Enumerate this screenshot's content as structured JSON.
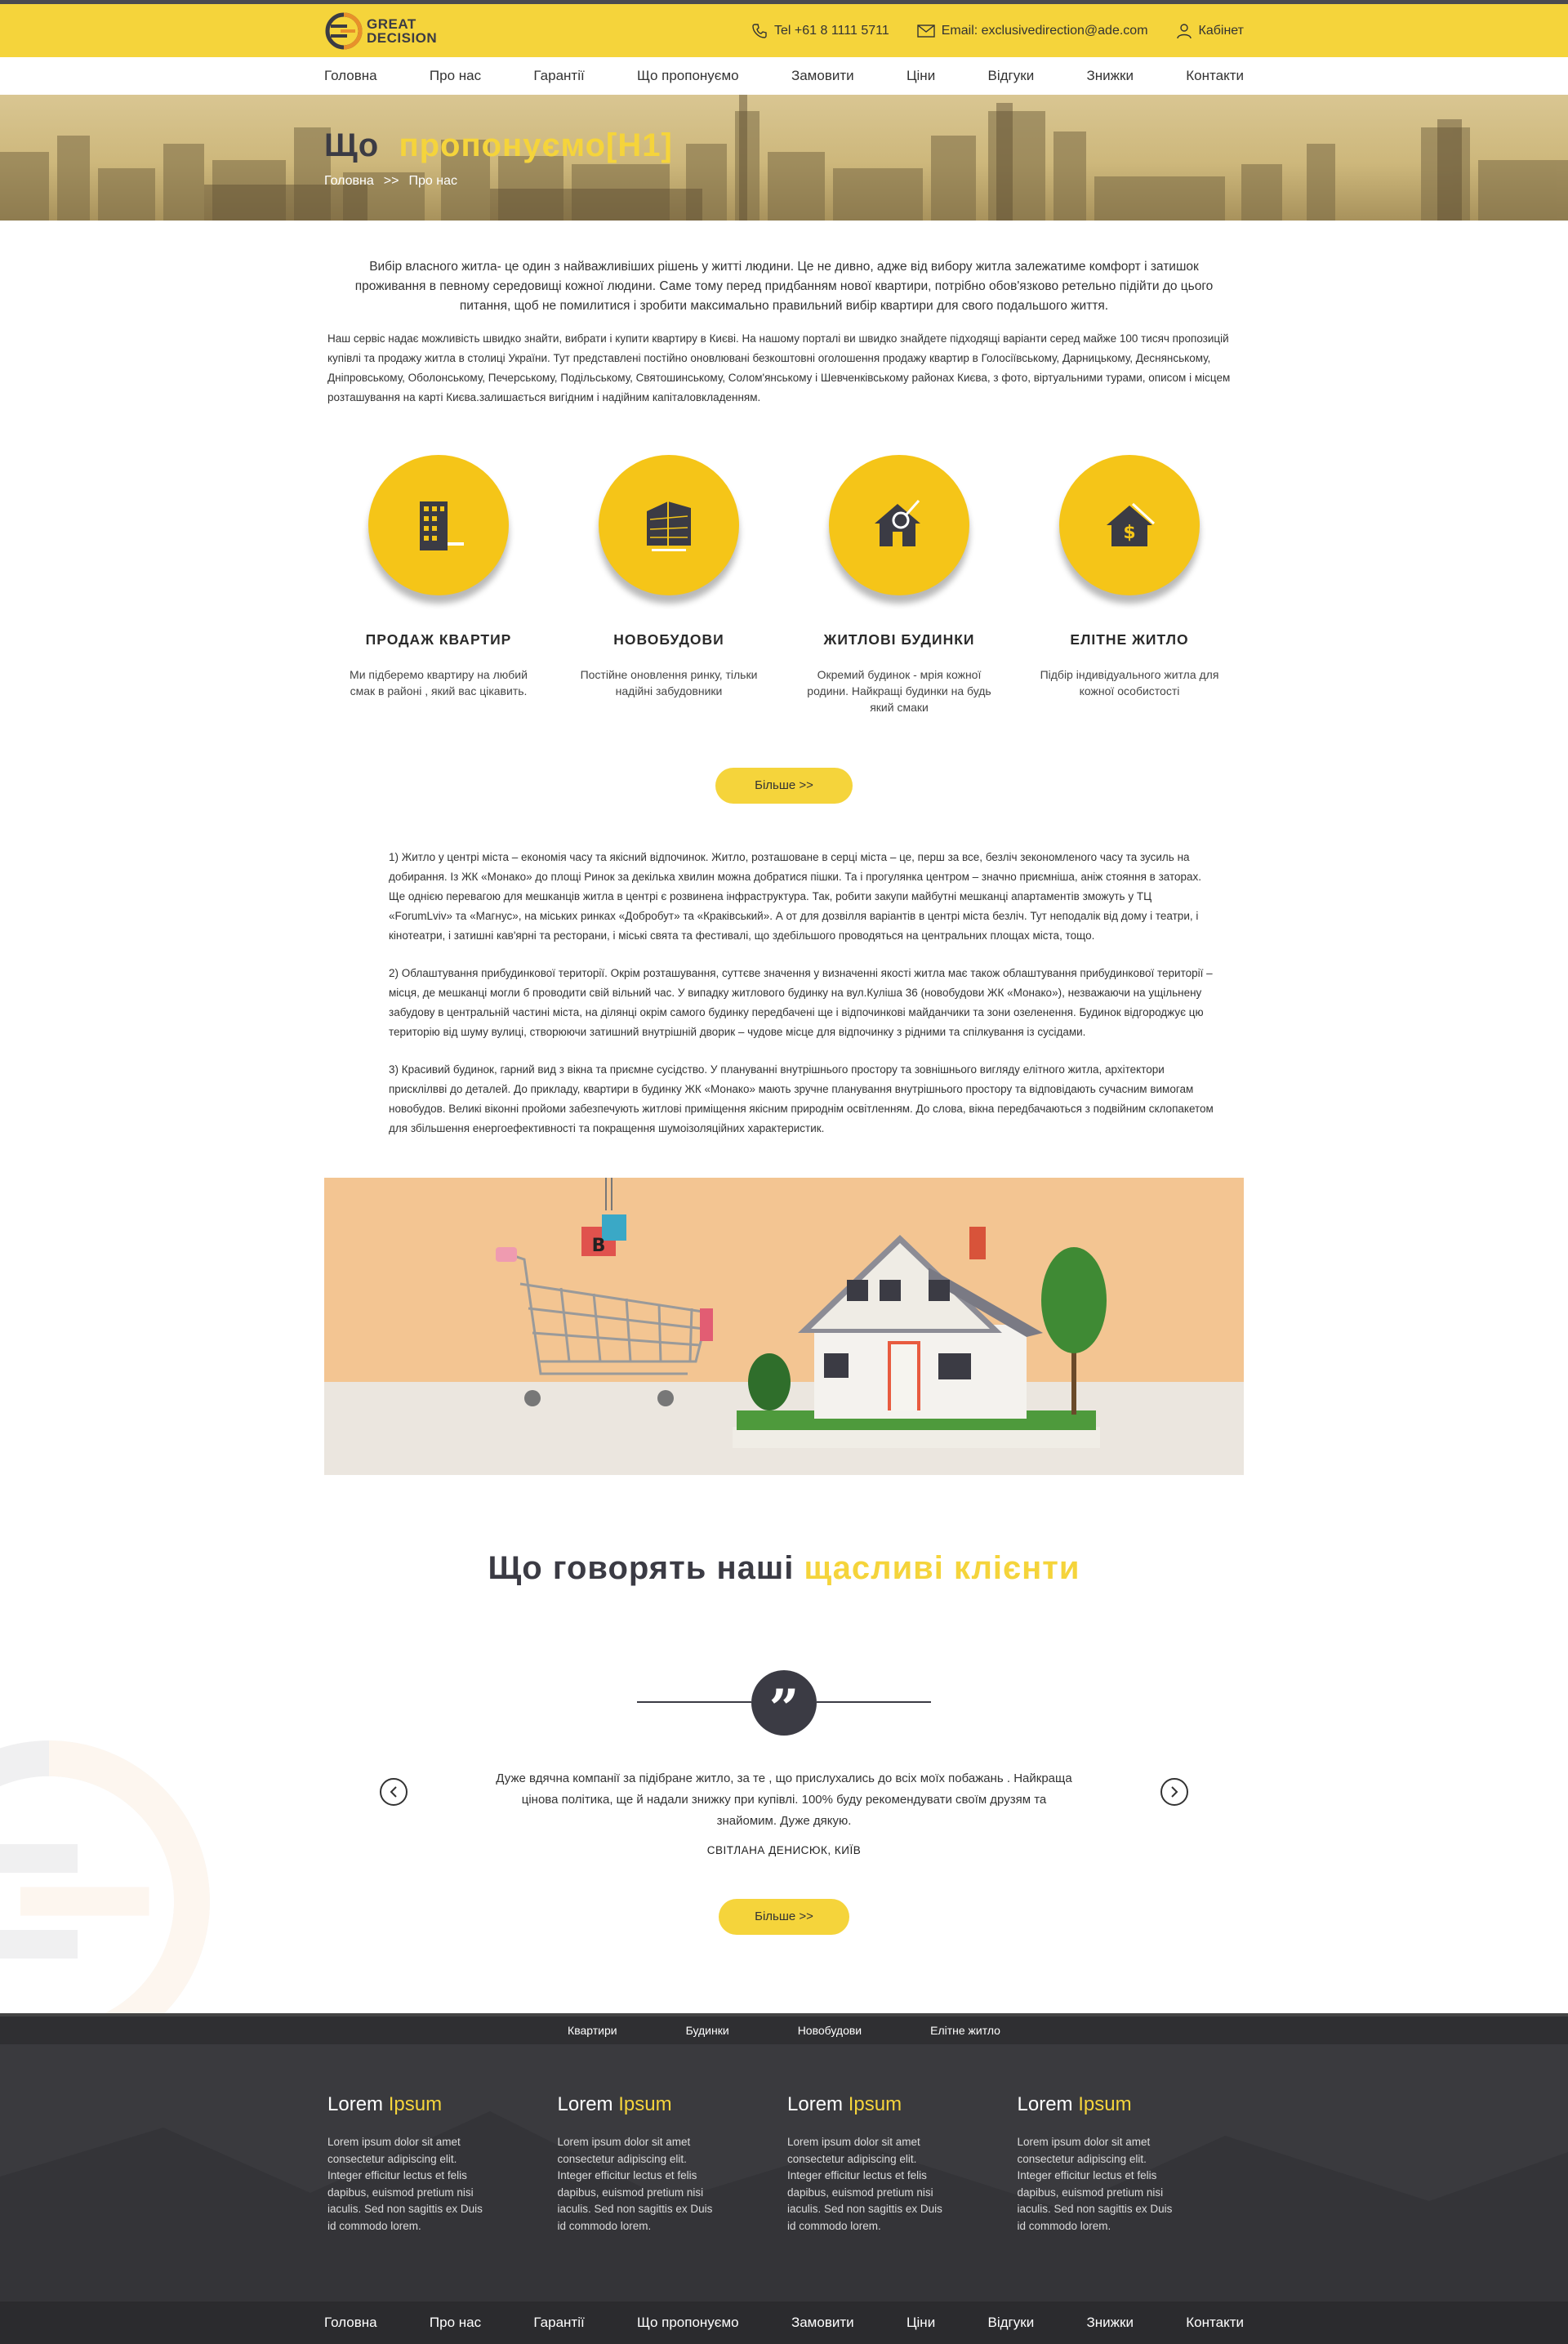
{
  "brand": {
    "line1": "GREAT",
    "line2": "DECISION"
  },
  "contacts": {
    "phone": "Tel +61 8 1111 5711",
    "email": "Email: exclusivedirection@ade.com",
    "cabinet": "Кабінет"
  },
  "nav": {
    "items": [
      "Головна",
      "Про нас",
      "Гарантії",
      "Що пропонуємо",
      "Замовити",
      "Ціни",
      "Відгуки",
      "Знижки",
      "Контакти"
    ]
  },
  "hero": {
    "title_dark": "Що",
    "title_yellow": "пропонуємо[H1]",
    "crumb_home": "Головна",
    "crumb_sep": ">>",
    "crumb_current": "Про нас"
  },
  "intro": {
    "lead": "Вибір власного житла- це один з найважливіших рішень у житті людини. Це не дивно, адже від вибору житла залежатиме комфорт і затишок проживання в певному середовищі кожної людини. Саме тому перед придбанням нової квартири, потрібно обов'язково ретельно підійти до цього питання, щоб не помилитися і зробити максимально правильний вибір квартири для свого подальшого життя.",
    "body": "Наш сервіс надає можливість швидко знайти, вибрати і купити квартиру в Києві. На нашому порталі ви швидко знайдете підходящі варіанти серед майже 100 тисяч пропозицій купівлі та продажу житла в столиці України. Тут представлені постійно оновлювані безкоштовні оголошення продажу квартир в Голосіївському, Дарницькому, Деснянському, Дніпровському, Оболонському, Печерському, Подільському, Святошинському, Солом'янському і Шевченківському районах Києва, з фото, віртуальними турами, описом і місцем розташування на карті Києва.залишається вигідним і надійним капіталовкладенням."
  },
  "services": [
    {
      "title": "ПРОДАЖ КВАРТИР",
      "text": "Ми підберемо квартиру на любий смак в районі , який вас цікавить.",
      "icon": "apartment-building-icon"
    },
    {
      "title": "НОВОБУДОВИ",
      "text": "Постійне оновлення ринку, тільки надійні забудовники",
      "icon": "new-building-icon"
    },
    {
      "title": "ЖИТЛОВІ БУДИНКИ",
      "text": "Окремий будинок - мрія кожної родини. Найкращі будинки на будь який смаки",
      "icon": "house-search-icon"
    },
    {
      "title": "ЕЛІТНЕ ЖИТЛО",
      "text": "Підбір індивідуального житла для кожної особистості",
      "icon": "house-dollar-icon"
    }
  ],
  "more_button": "Більше >>",
  "articles": [
    "1) Житло у центрі міста – економія часу та якісний відпочинок. Житло, розташоване в серці міста – це, перш за все, безліч зекономленого часу та зусиль на добирання. Із ЖК «Монако» до площі Ринок за декілька хвилин можна добратися пішки. Та і прогулянка центром – значно приємніша, аніж стояння в заторах.  Ще однією перевагою для мешканців житла в центрі є розвинена інфраструктура. Так, робити закупи майбутні мешканці апартаментів зможуть у ТЦ «ForumLviv» та «Магнус», на міських ринках «Добробут» та «Краківський». А от для дозвілля варіантів в центрі міста безліч. Тут неподалік від дому і театри, і кінотеатри, і затишні кав'ярні та ресторани, і міські свята та фестивалі, що здебільшого проводяться на центральних площах міста, тощо.",
    "2) Облаштування прибудинкової території. Окрім розташування, суттєве значення у визначенні якості житла має також облаштування прибудинкової території – місця, де мешканці могли б проводити свій вільний час. У випадку житлового будинку на вул.Куліша 36 (новобудови ЖК «Монако»), незважаючи на ущільнену забудову в центральній частині міста, на ділянці окрім самого будинку передбачені ще і відпочинкові майданчики та зони озеленення. Будинок відгороджує цю територію від шуму вулиці, створюючи затишний внутрішній дворик – чудове місце для відпочинку з рідними та спілкування із сусідами.",
    "3) Красивий будинок, гарний вид з вікна та приємне сусідство.  У плануванні внутрішнього простору та зовнішнього вигляду елітного житла, архітектори присклілвві до деталей. До прикладу, квартири в будинку ЖК «Монако» мають зручне планування внутрішнього простору та відповідають сучасним вимогам новобудов. Великі віконні пройоми забезпечують житлові приміщення якісним природнім освітленням. До слова, вікна передбачаються з подвійним склопакетом для збільшення енергоефективності та покращення шумоізоляційних характеристик."
  ],
  "testimonials": {
    "title_dark": "Що говорять наші",
    "title_yellow": "щасливі клієнти",
    "text": "Дуже вдячна компанії за підібране житло, за те , що прислухались до всіх моїх побажань . Найкраща цінова політика, ще й надали  знижку при купівлі. 100% буду рекомендувати своїм друзям та знайомим. Дуже дякую.",
    "author": "СВІТЛАНА ДЕНИСЮК, КИЇВ",
    "quote_glyph": "”"
  },
  "footer": {
    "top_links": [
      "Квартири",
      "Будинки",
      "Новобудови",
      "Елітне житло"
    ],
    "columns": [
      {
        "title_white": "Lorem",
        "title_yellow": "Ipsum",
        "text": "Lorem ipsum dolor sit amet consectetur adipiscing elit. Integer efficitur lectus et felis dapibus, euismod pretium nisi iaculis. Sed non sagittis ex Duis id commodo lorem."
      },
      {
        "title_white": "Lorem",
        "title_yellow": "Ipsum",
        "text": "Lorem ipsum dolor sit amet consectetur adipiscing elit. Integer efficitur lectus et felis dapibus, euismod pretium nisi iaculis. Sed non sagittis ex Duis id commodo lorem."
      },
      {
        "title_white": "Lorem",
        "title_yellow": "Ipsum",
        "text": "Lorem ipsum dolor sit amet consectetur adipiscing elit. Integer efficitur lectus et felis dapibus, euismod pretium nisi iaculis. Sed non sagittis ex Duis id commodo lorem."
      },
      {
        "title_white": "Lorem",
        "title_yellow": "Ipsum",
        "text": "Lorem ipsum dolor sit amet consectetur adipiscing elit. Integer efficitur lectus et felis dapibus, euismod pretium nisi iaculis. Sed non sagittis ex Duis id commodo lorem."
      }
    ]
  },
  "colors": {
    "accent": "#f5d43b",
    "dark": "#3b3b44",
    "footer": "#3a3a3e"
  }
}
